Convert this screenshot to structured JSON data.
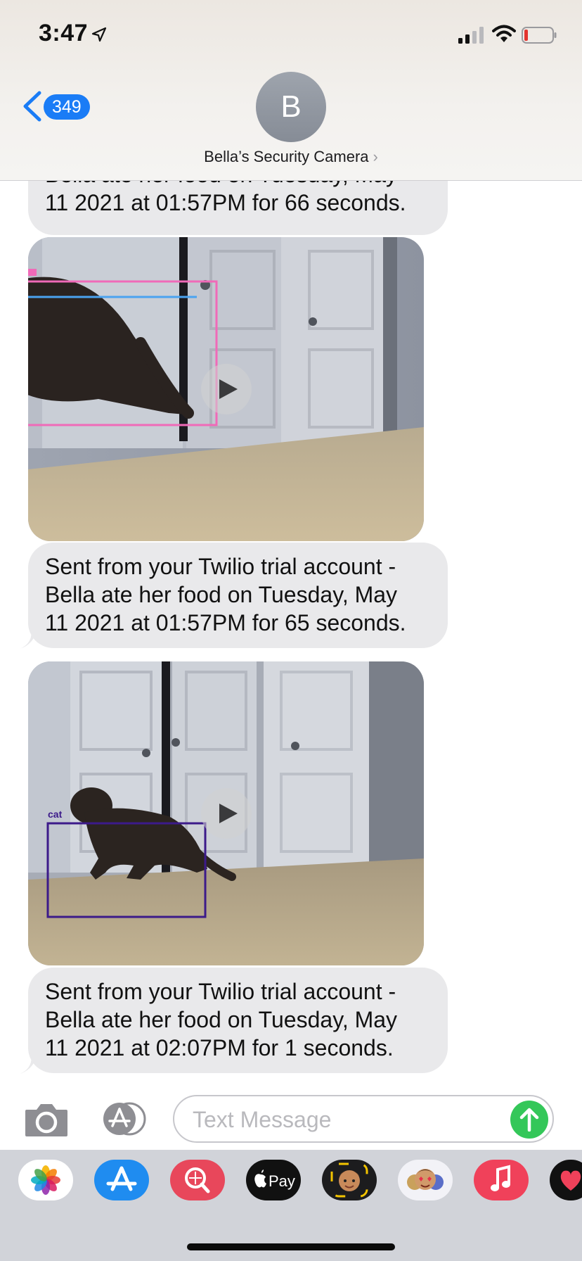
{
  "status_bar": {
    "time": "3:47"
  },
  "header": {
    "back_count": "349",
    "avatar_initial": "B",
    "contact_name": "Bella’s Security Camera",
    "contact_chevron": "›"
  },
  "messages": [
    {
      "type": "text",
      "lines": [
        "Bella ate her food on Tuesday, May",
        "11 2021 at 01:57PM for 66 seconds."
      ]
    },
    {
      "type": "video",
      "icon": "play-icon",
      "detection_label": ""
    },
    {
      "type": "text",
      "lines": [
        "Sent from your Twilio trial account -",
        "Bella ate her food on Tuesday, May",
        "11 2021 at 01:57PM for 65 seconds."
      ]
    },
    {
      "type": "video",
      "icon": "play-icon",
      "detection_label": "cat"
    },
    {
      "type": "text",
      "lines": [
        "Sent from your Twilio trial account -",
        "Bella ate her food on Tuesday, May",
        "11 2021 at 02:07PM for 1 seconds."
      ]
    }
  ],
  "composer": {
    "placeholder": "Text Message"
  },
  "drawer": {
    "apps": [
      "photos-app-icon",
      "app-store-icon",
      "search-images-icon",
      "apple-pay-icon",
      "memoji-icon",
      "animoji-stickers-icon",
      "music-icon",
      "digital-touch-icon"
    ],
    "apple_pay_label": "Pay"
  },
  "colors": {
    "bubble_gray": "#e9e9eb",
    "ios_blue": "#1a7cf6",
    "send_green": "#34c759",
    "drawer_bg": "#d1d3d9",
    "detection_pink": "#f06ab8",
    "detection_blue": "#4aa3f0",
    "detection_purple": "#3c1a8a"
  }
}
